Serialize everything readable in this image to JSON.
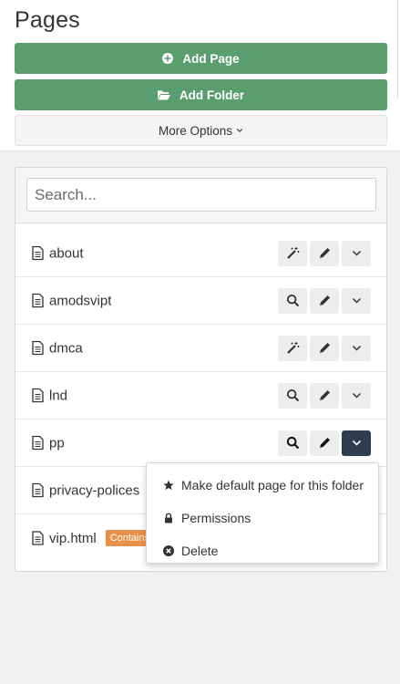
{
  "header": {
    "title": "Pages",
    "add_page_label": "Add Page",
    "add_folder_label": "Add Folder",
    "more_options_label": "More Options"
  },
  "search": {
    "placeholder": "Search..."
  },
  "pages": [
    {
      "name": "about",
      "first_action": "magic-wand"
    },
    {
      "name": "amodsvipt",
      "first_action": "search"
    },
    {
      "name": "dmca",
      "first_action": "magic-wand"
    },
    {
      "name": "lnd",
      "first_action": "search"
    },
    {
      "name": "pp",
      "first_action": "search"
    },
    {
      "name": "privacy-polices"
    },
    {
      "name": "vip.html",
      "badge": "Contains"
    }
  ],
  "dropdown_menu": {
    "items": [
      {
        "label": "Make default page for this folder",
        "icon": "star-icon"
      },
      {
        "label": "Permissions",
        "icon": "lock-icon"
      },
      {
        "label": "Delete",
        "icon": "times-circle-icon"
      }
    ]
  },
  "colors": {
    "green_button": "#5a9e6f",
    "dark_button": "#2f3e4e",
    "badge_orange": "#e8914a"
  }
}
